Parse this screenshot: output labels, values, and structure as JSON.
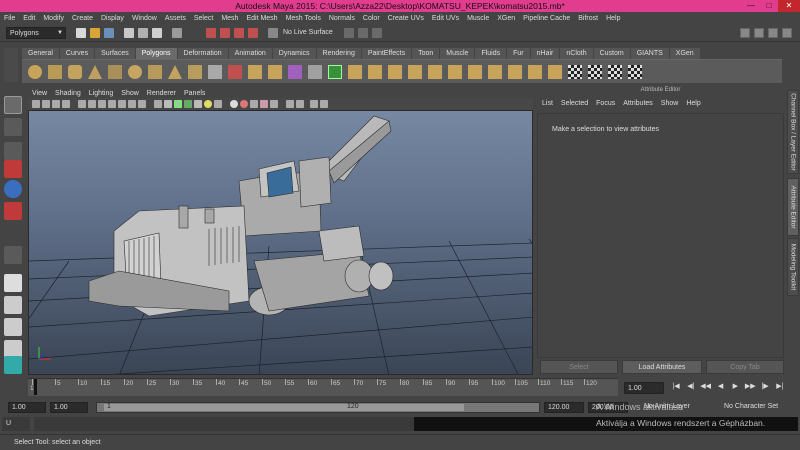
{
  "window": {
    "title": "Autodesk Maya 2015: C:\\Users\\Azza22\\Desktop\\KOMATSU_KEPEK\\komatsu2015.mb*",
    "minimize": "—",
    "maximize": "□",
    "close": "✕"
  },
  "menubar": [
    "File",
    "Edit",
    "Modify",
    "Create",
    "Display",
    "Window",
    "Assets",
    "Select",
    "Mesh",
    "Edit Mesh",
    "Mesh Tools",
    "Normals",
    "Color",
    "Create UVs",
    "Edit UVs",
    "Muscle",
    "XGen",
    "Pipeline Cache",
    "Bifrost",
    "Help"
  ],
  "statusline": {
    "mode": "Polygons",
    "live_surface": "No Live Surface"
  },
  "shelf": {
    "tabs": [
      "General",
      "Curves",
      "Surfaces",
      "Polygons",
      "Deformation",
      "Animation",
      "Dynamics",
      "Rendering",
      "PaintEffects",
      "Toon",
      "Muscle",
      "Fluids",
      "Fur",
      "nHair",
      "nCloth",
      "Custom",
      "GIANTS",
      "XGen"
    ],
    "active_tab": "Polygons"
  },
  "viewport": {
    "menu": [
      "View",
      "Shading",
      "Lighting",
      "Show",
      "Renderer",
      "Panels"
    ]
  },
  "attribute_editor": {
    "title": "Attribute Editor",
    "menu": [
      "List",
      "Selected",
      "Focus",
      "Attributes",
      "Show",
      "Help"
    ],
    "message": "Make a selection to view attributes",
    "select_button": "Select",
    "load_button": "Load Attributes",
    "copy_button": "Copy Tab"
  },
  "right_tabs": [
    "Channel Box / Layer Editor",
    "Attribute Editor",
    "Modeling Toolkit"
  ],
  "timeline": {
    "ticks": [
      "1",
      "5",
      "10",
      "15",
      "20",
      "25",
      "30",
      "35",
      "40",
      "45",
      "50",
      "55",
      "60",
      "65",
      "70",
      "75",
      "80",
      "85",
      "90",
      "95",
      "100",
      "105",
      "110",
      "115",
      "120"
    ],
    "current_frame": "1.00",
    "playback": [
      "|◀",
      "◀|",
      "◀◀",
      "◀",
      "▶",
      "▶▶",
      "|▶",
      "▶|"
    ]
  },
  "range": {
    "start": "1.00",
    "playback_start": "1.00",
    "slider_left": "1",
    "slider_right": "120",
    "playback_end": "120.00",
    "end": "200.00",
    "anim_layer": "No Anim Layer",
    "character_set": "No Character Set"
  },
  "watermark": {
    "line1": "A Windows aktiválása",
    "line2": "Aktiválja a Windows rendszert a Gépházban."
  },
  "commandline": {
    "mel": "U"
  },
  "helpline": "Select Tool: select an object",
  "colors": {
    "titlebar": "#e23c8f",
    "viewport_top": "#7788a2",
    "viewport_bottom": "#3a4555"
  }
}
